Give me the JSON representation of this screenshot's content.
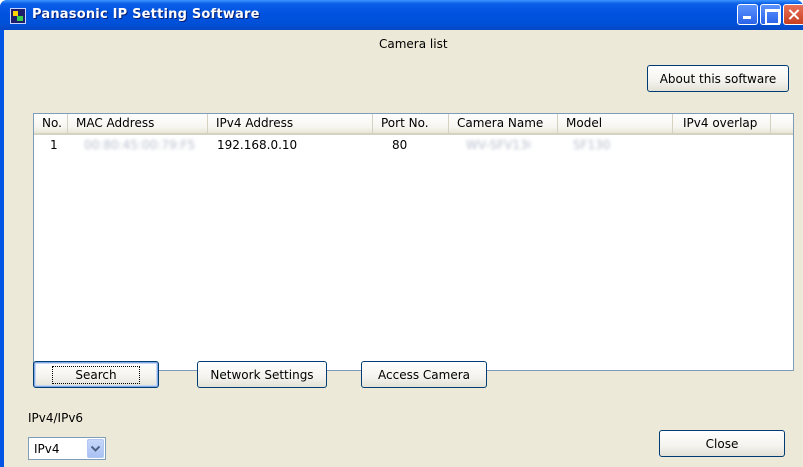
{
  "window": {
    "title": "Panasonic IP Setting Software"
  },
  "header": {
    "camera_list_label": "Camera list",
    "about_button": "About this software"
  },
  "table": {
    "columns": [
      "No.",
      "MAC Address",
      "IPv4 Address",
      "Port No.",
      "Camera Name",
      "Model",
      "IPv4 overlap"
    ],
    "rows": [
      {
        "no": "1",
        "mac": "00:80:45:00:79:F5",
        "ipv4": "192.168.0.10",
        "port": "80",
        "camera_name": "WV-SFV130",
        "model": "SF130",
        "overlap": ""
      }
    ]
  },
  "actions": {
    "search": "Search",
    "network_settings": "Network Settings",
    "access_camera": "Access Camera"
  },
  "ip_mode": {
    "label": "IPv4/IPv6",
    "selected": "IPv4"
  },
  "footer": {
    "close": "Close"
  },
  "colors": {
    "titlebar": "#0050d8",
    "client_bg": "#ece9d8",
    "button_border": "#003c74"
  },
  "icons": [
    "app-icon",
    "minimize-icon",
    "maximize-icon",
    "close-icon",
    "chevron-down-icon"
  ]
}
